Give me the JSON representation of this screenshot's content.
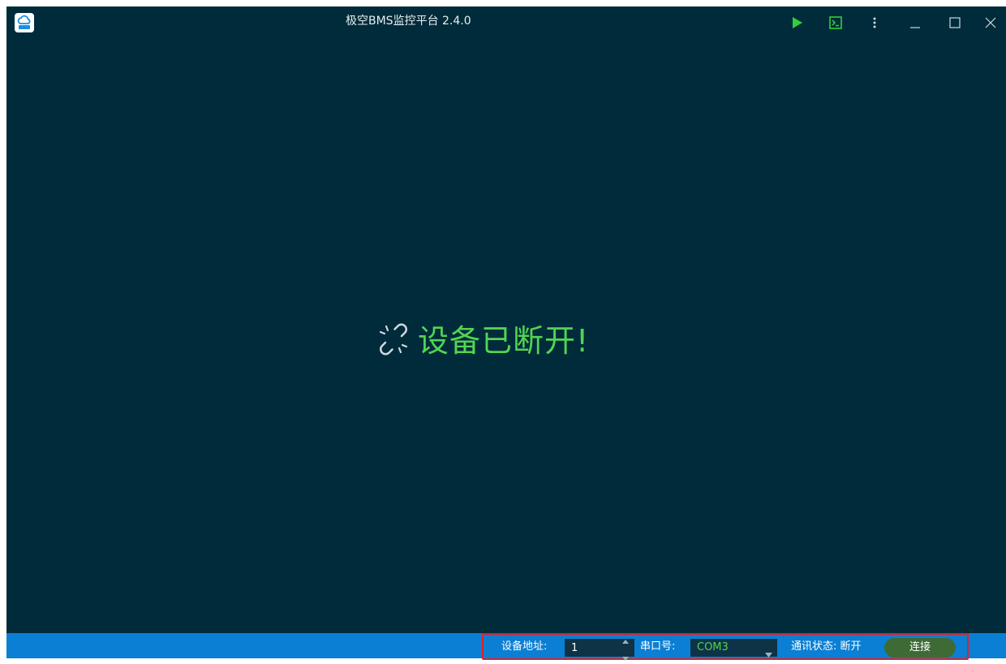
{
  "window": {
    "title": "极空BMS监控平台 2.4.0"
  },
  "logo": {
    "icon": "cloud-logo-icon"
  },
  "toolbar": {
    "play_icon": "play-icon",
    "console_icon": "terminal-icon",
    "more_icon": "more-vertical-icon",
    "minimize_icon": "minimize-icon",
    "maximize_icon": "maximize-icon",
    "close_icon": "close-icon"
  },
  "main": {
    "disconnect_message": "设备已断开!",
    "disconnect_icon": "broken-link-icon"
  },
  "statusbar": {
    "device_address_label": "设备地址:",
    "device_address_value": "1",
    "port_label": "串口号:",
    "port_value": "COM3",
    "comm_status_label": "通讯状态: 断开",
    "connect_label": "连接"
  },
  "colors": {
    "background": "#002b3a",
    "accent_green": "#52d452",
    "statusbar_blue": "#0b7fd4",
    "highlight_red": "#e0202a",
    "connect_button": "#3e6a36"
  }
}
